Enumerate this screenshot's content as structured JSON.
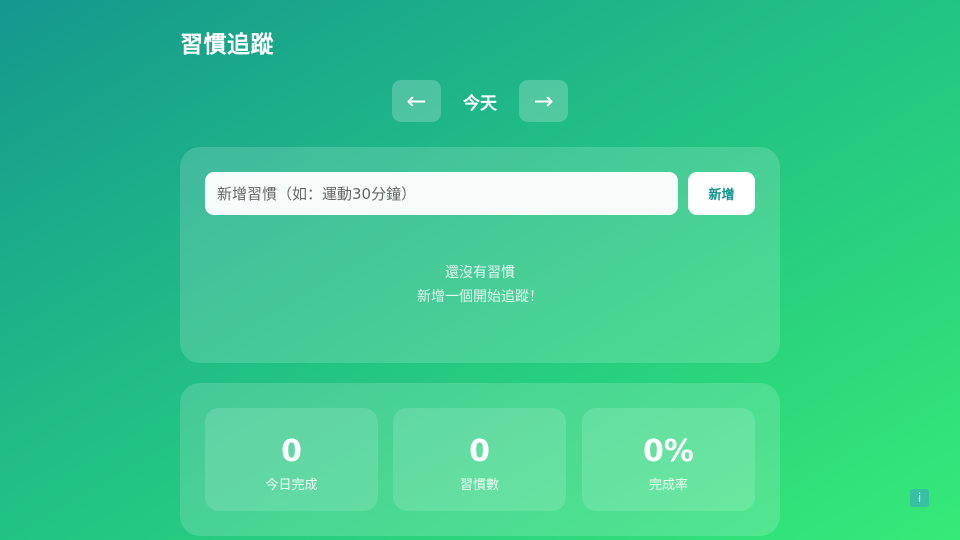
{
  "header": {
    "title": "習慣追蹤"
  },
  "date_nav": {
    "prev_icon": "←",
    "label": "今天",
    "next_icon": "→"
  },
  "habit_form": {
    "placeholder": "新增習慣（如：運動30分鐘）",
    "value": "",
    "add_label": "新增"
  },
  "empty_state": {
    "line1": "還沒有習慣",
    "line2": "新增一個開始追蹤！"
  },
  "stats": [
    {
      "value": "0",
      "label": "今日完成"
    },
    {
      "value": "0",
      "label": "習慣數"
    },
    {
      "value": "0%",
      "label": "完成率"
    }
  ],
  "info_button": {
    "icon": "i"
  },
  "colors": {
    "gradient_start": "#15978e",
    "gradient_end": "#36ea78",
    "add_button_text": "#16958e"
  }
}
